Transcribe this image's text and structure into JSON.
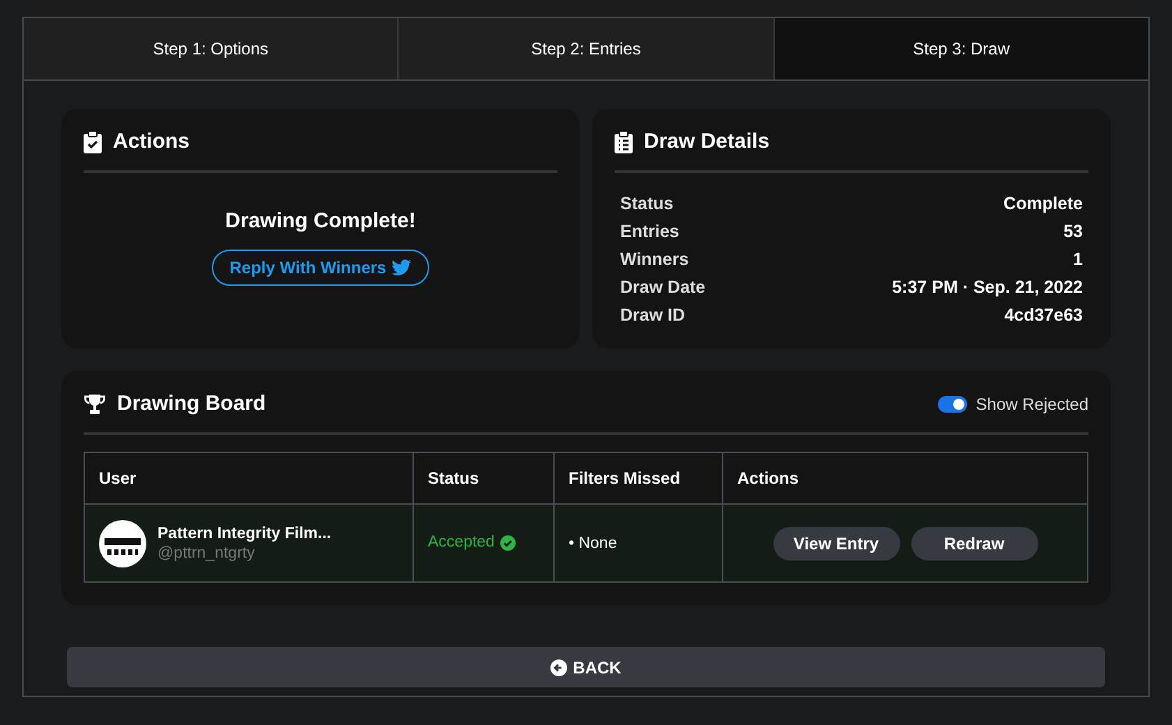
{
  "tabs": [
    {
      "label": "Step 1: Options",
      "selected": false
    },
    {
      "label": "Step 2: Entries",
      "selected": false
    },
    {
      "label": "Step 3: Draw",
      "selected": true
    }
  ],
  "actions": {
    "title": "Actions",
    "message": "Drawing Complete!",
    "reply_button": "Reply With Winners"
  },
  "draw_details": {
    "title": "Draw Details",
    "rows": [
      {
        "label": "Status",
        "value": "Complete"
      },
      {
        "label": "Entries",
        "value": "53"
      },
      {
        "label": "Winners",
        "value": "1"
      },
      {
        "label": "Draw Date",
        "value": "5:37 PM · Sep. 21, 2022"
      },
      {
        "label": "Draw ID",
        "value": "4cd37e63"
      }
    ]
  },
  "drawing_board": {
    "title": "Drawing Board",
    "show_rejected": {
      "label": "Show Rejected",
      "on": true
    },
    "table": {
      "columns": [
        "User",
        "Status",
        "Filters Missed",
        "Actions"
      ],
      "rows": [
        {
          "name": "Pattern Integrity Film...",
          "handle": "@pttrn_ntgrty",
          "status": "Accepted",
          "accepted": true,
          "filters_missed": "• None",
          "buttons": [
            "View Entry",
            "Redraw"
          ]
        }
      ]
    }
  },
  "back_button": "BACK"
}
